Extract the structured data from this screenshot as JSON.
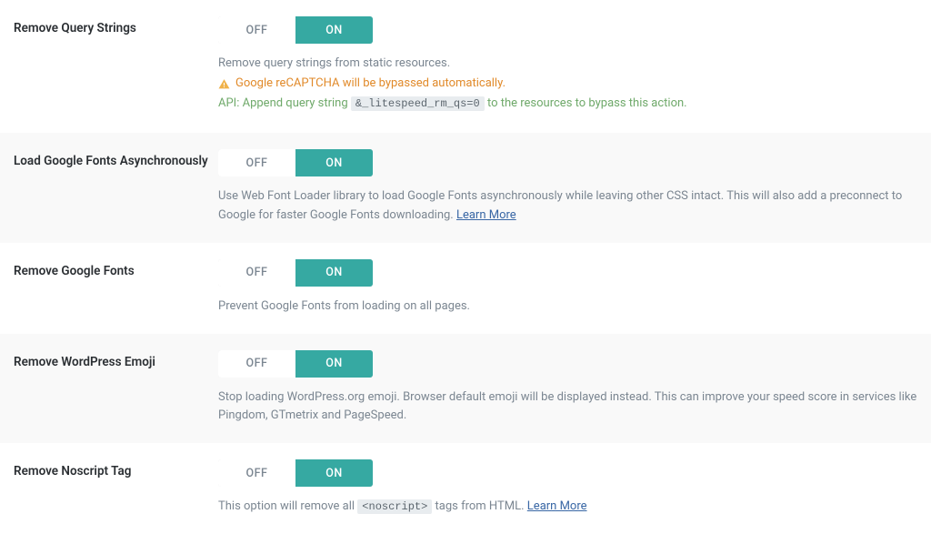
{
  "toggle": {
    "off": "OFF",
    "on": "ON"
  },
  "learnMore": "Learn More",
  "rows": {
    "removeQueryStrings": {
      "label": "Remove Query Strings",
      "desc1": "Remove query strings from static resources.",
      "warn": "Google reCAPTCHA will be bypassed automatically.",
      "apiPrefix": "API: Append query string ",
      "apiCode": "&_litespeed_rm_qs=0",
      "apiSuffix": " to the resources to bypass this action."
    },
    "loadGoogleFontsAsync": {
      "label": "Load Google Fonts Asynchronously",
      "desc": "Use Web Font Loader library to load Google Fonts asynchronously while leaving other CSS intact. This will also add a preconnect to Google for faster Google Fonts downloading. "
    },
    "removeGoogleFonts": {
      "label": "Remove Google Fonts",
      "desc": "Prevent Google Fonts from loading on all pages."
    },
    "removeWpEmoji": {
      "label": "Remove WordPress Emoji",
      "desc": "Stop loading WordPress.org emoji. Browser default emoji will be displayed instead. This can improve your speed score in services like Pingdom, GTmetrix and PageSpeed."
    },
    "removeNoscript": {
      "label": "Remove Noscript Tag",
      "descPrefix": "This option will remove all ",
      "descCode": "<noscript>",
      "descSuffix": " tags from HTML. "
    }
  }
}
